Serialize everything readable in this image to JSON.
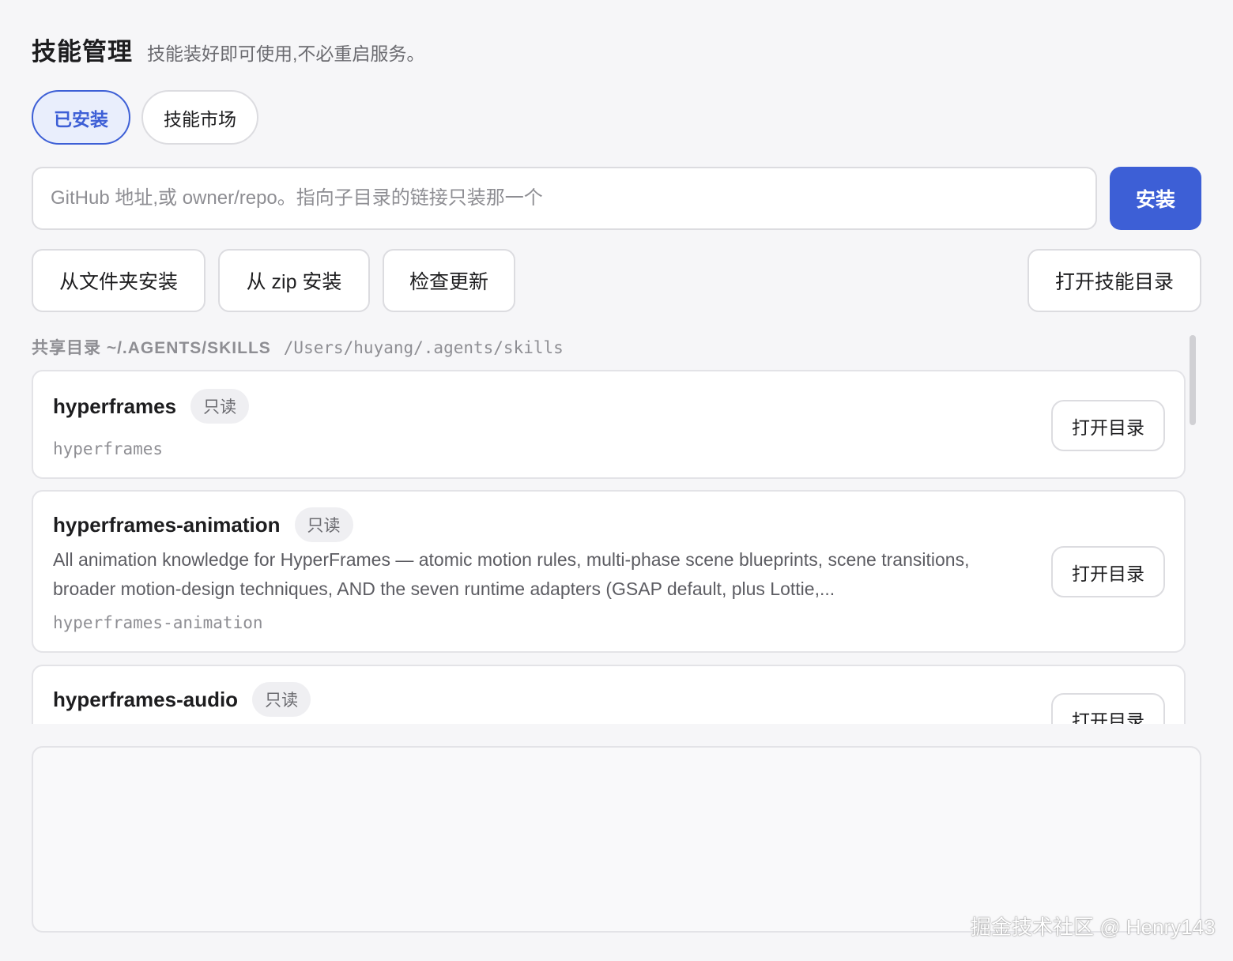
{
  "header": {
    "title": "技能管理",
    "subtitle": "技能装好即可使用,不必重启服务。"
  },
  "tabs": [
    {
      "label": "已安装",
      "active": true
    },
    {
      "label": "技能市场",
      "active": false
    }
  ],
  "install": {
    "placeholder": "GitHub 地址,或 owner/repo。指向子目录的链接只装那一个",
    "value": "",
    "button_label": "安装"
  },
  "actions": {
    "from_folder": "从文件夹安装",
    "from_zip": "从 zip 安装",
    "check_updates": "检查更新",
    "open_skills_dir": "打开技能目录"
  },
  "shared_dir": {
    "label": "共享目录 ~/.AGENTS/SKILLS",
    "path": "/Users/huyang/.agents/skills"
  },
  "skills": [
    {
      "name": "hyperframes",
      "badge": "只读",
      "description": "",
      "slug": "hyperframes",
      "open_label": "打开目录"
    },
    {
      "name": "hyperframes-animation",
      "badge": "只读",
      "description": "All animation knowledge for HyperFrames — atomic motion rules, multi-phase scene blueprints, scene transitions, broader motion-design techniques, AND the seven runtime adapters (GSAP default, plus Lottie,...",
      "slug": "hyperframes-animation",
      "open_label": "打开目录"
    },
    {
      "name": "hyperframes-audio",
      "badge": "只读",
      "description": "",
      "slug": "",
      "open_label": "打开目录"
    }
  ],
  "watermark": "掘金技术社区 @ Henry143",
  "colors": {
    "accent": "#3d5fd6",
    "accent_bg": "#e9eefc",
    "background": "#f6f6f8",
    "border": "#dcdce0"
  }
}
